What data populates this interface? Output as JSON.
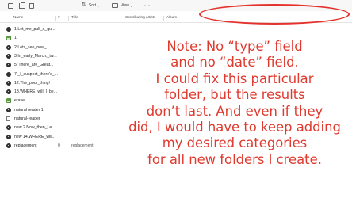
{
  "toolbar": {
    "sort_label": "Sort",
    "view_label": "View",
    "more_label": "···"
  },
  "columns": {
    "name": "Name",
    "number": "#",
    "title": "Title",
    "contributing_artists": "Contributing artists",
    "album": "Album"
  },
  "files": [
    {
      "icon": "gear-icon",
      "name": "1.Let_me_pull_a_qu...",
      "number": "",
      "title": ""
    },
    {
      "icon": "image-icon",
      "name": "1",
      "number": "",
      "title": ""
    },
    {
      "icon": "gear-icon",
      "name": "2.Lets_see_now_...",
      "number": "",
      "title": ""
    },
    {
      "icon": "gear-icon",
      "name": "3.In_early_March,_tw...",
      "number": "",
      "title": ""
    },
    {
      "icon": "gear-icon",
      "name": "5.'There_are_Great...",
      "number": "",
      "title": ""
    },
    {
      "icon": "gear-icon",
      "name": "7._I_suspect_there's_...",
      "number": "",
      "title": ""
    },
    {
      "icon": "gear-icon",
      "name": "12.The_poor_thing!",
      "number": "",
      "title": ""
    },
    {
      "icon": "gear-icon",
      "name": "13.WHERE_will_I_be...",
      "number": "",
      "title": ""
    },
    {
      "icon": "image-icon",
      "name": "erase",
      "number": "",
      "title": ""
    },
    {
      "icon": "gear-icon",
      "name": "natural reader 1",
      "number": "",
      "title": ""
    },
    {
      "icon": "document-icon",
      "name": "natural-reader",
      "number": "",
      "title": ""
    },
    {
      "icon": "gear-icon",
      "name": "new 2.Now_then_Le...",
      "number": "",
      "title": ""
    },
    {
      "icon": "gear-icon",
      "name": "new 14.WHERE_will...",
      "number": "",
      "title": ""
    },
    {
      "icon": "gear-icon",
      "name": "replacement",
      "number": "0",
      "title": "replacement"
    }
  ],
  "annotation": {
    "lines": [
      "Note: No “type” field",
      "and no “date” field.",
      "I could fix this particular",
      "folder, but the results",
      "don’t last. And even if they",
      "did, I would have to keep adding",
      "my desired categories",
      "for all new folders I create."
    ],
    "color": "#e03a2f",
    "oval_color": "#e5312b"
  }
}
